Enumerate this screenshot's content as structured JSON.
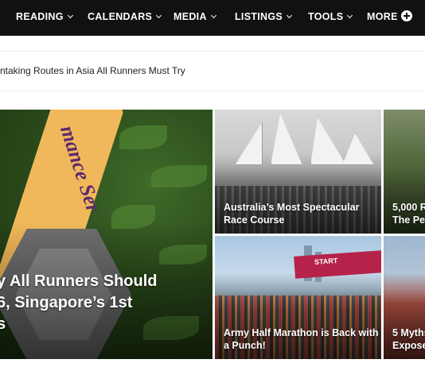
{
  "nav": {
    "items": [
      {
        "label": "READING"
      },
      {
        "label": "CALENDARS"
      },
      {
        "label": "MEDIA"
      },
      {
        "label": "LISTINGS"
      },
      {
        "label": "TOOLS"
      }
    ],
    "more_label": "MORE"
  },
  "ticker": {
    "text": "ntaking Routes in Asia All Runners Must Try"
  },
  "feature": {
    "medal_ribbon_text": "mance Ser",
    "title_line1": "y All Runners Should",
    "title_line2": "6, Singapore’s 1st",
    "title_line3": "s"
  },
  "tiles": {
    "sydney": {
      "title_line1": "Australia’s Most Spectacular",
      "title_line2": "Race Course"
    },
    "forest": {
      "title_line1": "5,000 R",
      "title_line2": "The Per"
    },
    "army": {
      "title_line1": "Army Half Marathon is Back with",
      "title_line2": "a Punch!",
      "arch_text": "START"
    },
    "myths": {
      "title_line1": "5 Myths",
      "title_line2": "Expose"
    }
  },
  "colors": {
    "nav_background": "#111111",
    "nav_text": "#ffffff",
    "title_text": "#ffffff"
  }
}
